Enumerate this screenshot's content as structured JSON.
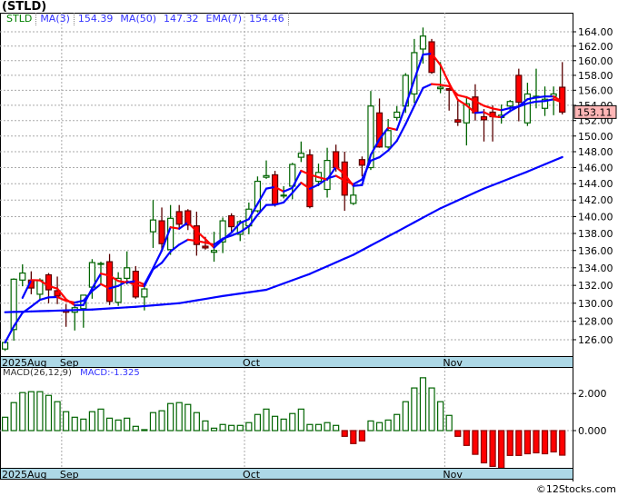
{
  "title": "(STLD)",
  "legend": {
    "symbol": "STLD",
    "ma3_label": "MA(3)",
    "ma3_value": "154.39",
    "ma50_label": "MA(50)",
    "ma50_value": "147.32",
    "ema7_label": "EMA(7)",
    "ema7_value": "154.46"
  },
  "last_price_label": "153.11",
  "macd_legend": {
    "label": "MACD(26,12,9)",
    "value": "MACD:-1.325"
  },
  "copyright": "©12Stocks.com",
  "colors": {
    "up": "#006400",
    "down": "#ff0000",
    "ma_up": "#0000ff",
    "ma_down": "#ff0000",
    "axis_band": "#add8e6",
    "last_price_bg": "#ffb6b6",
    "symbol_text": "#008000",
    "legend_text": "#3333ff"
  },
  "chart_data": [
    {
      "type": "candlestick",
      "symbol": "STLD",
      "y_scale": "log",
      "ylim": [
        124.2,
        166.6
      ],
      "y_ticks": [
        "126.00",
        "128.00",
        "130.00",
        "132.00",
        "134.00",
        "136.00",
        "138.00",
        "140.00",
        "142.00",
        "144.00",
        "146.00",
        "148.00",
        "150.00",
        "152.00",
        "154.00",
        "156.00",
        "158.00",
        "160.00",
        "162.00",
        "164.00"
      ],
      "x_labels": [
        {
          "label": "2025Aug",
          "index": 0
        },
        {
          "label": "Sep",
          "index": 7
        },
        {
          "label": "Oct",
          "index": 28
        },
        {
          "label": "Nov",
          "index": 51
        }
      ],
      "grid": true,
      "ohlc": [
        [
          125.0,
          125.9,
          124.8,
          125.7
        ],
        [
          127.1,
          132.8,
          125.9,
          132.7
        ],
        [
          132.6,
          134.4,
          131.9,
          133.4
        ],
        [
          132.6,
          133.6,
          131.0,
          131.7
        ],
        [
          131.0,
          132.8,
          130.4,
          132.6
        ],
        [
          133.2,
          133.4,
          130.0,
          131.5
        ],
        [
          131.4,
          133.0,
          129.9,
          130.8
        ],
        [
          129.2,
          129.9,
          127.4,
          129.0
        ],
        [
          129.0,
          129.9,
          127.0,
          129.5
        ],
        [
          129.4,
          130.9,
          127.3,
          130.9
        ],
        [
          131.8,
          135.0,
          130.5,
          134.6
        ],
        [
          134.4,
          134.7,
          132.1,
          134.5
        ],
        [
          134.7,
          135.6,
          129.8,
          130.2
        ],
        [
          130.1,
          133.5,
          129.7,
          132.8
        ],
        [
          132.8,
          135.9,
          132.1,
          134.0
        ],
        [
          133.6,
          134.2,
          130.5,
          130.7
        ],
        [
          130.7,
          131.9,
          129.2,
          131.6
        ],
        [
          138.2,
          142.0,
          136.3,
          139.6
        ],
        [
          139.5,
          141.1,
          135.9,
          136.8
        ],
        [
          136.1,
          141.4,
          135.5,
          139.8
        ],
        [
          140.6,
          141.4,
          138.7,
          139.1
        ],
        [
          140.7,
          140.9,
          138.4,
          139.0
        ],
        [
          138.9,
          140.6,
          135.4,
          136.7
        ],
        [
          136.5,
          137.6,
          136.1,
          136.3
        ],
        [
          135.8,
          138.2,
          134.7,
          136.0
        ],
        [
          137.0,
          139.9,
          135.7,
          139.5
        ],
        [
          140.1,
          140.4,
          138.2,
          138.8
        ],
        [
          137.9,
          139.6,
          137.1,
          139.4
        ],
        [
          138.9,
          141.7,
          137.9,
          140.9
        ],
        [
          140.7,
          144.9,
          140.5,
          144.3
        ],
        [
          144.8,
          146.9,
          144.6,
          145.0
        ],
        [
          145.1,
          145.6,
          141.2,
          141.5
        ],
        [
          142.5,
          143.7,
          142.2,
          142.6
        ],
        [
          143.7,
          146.6,
          142.1,
          146.4
        ],
        [
          147.3,
          149.3,
          146.7,
          147.8
        ],
        [
          147.6,
          148.3,
          141.0,
          141.2
        ],
        [
          144.3,
          146.5,
          143.7,
          145.4
        ],
        [
          143.3,
          148.5,
          142.3,
          146.9
        ],
        [
          148.0,
          148.9,
          145.5,
          146.0
        ],
        [
          146.7,
          148.0,
          140.7,
          142.6
        ],
        [
          141.6,
          143.7,
          141.4,
          142.6
        ],
        [
          147.0,
          147.4,
          144.9,
          146.3
        ],
        [
          146.0,
          155.9,
          145.7,
          153.9
        ],
        [
          153.0,
          154.9,
          148.5,
          148.6
        ],
        [
          148.6,
          152.2,
          148.4,
          150.7
        ],
        [
          152.4,
          153.9,
          152.0,
          153.1
        ],
        [
          153.9,
          158.3,
          153.0,
          158.0
        ],
        [
          155.5,
          163.0,
          154.3,
          161.1
        ],
        [
          161.6,
          164.6,
          159.6,
          163.4
        ],
        [
          162.6,
          163.0,
          158.2,
          158.4
        ],
        [
          156.2,
          159.8,
          155.6,
          156.4
        ],
        [
          156.2,
          156.3,
          153.3,
          156.0
        ],
        [
          152.1,
          154.6,
          151.3,
          151.8
        ],
        [
          151.7,
          155.2,
          148.8,
          154.2
        ],
        [
          155.1,
          156.8,
          152.0,
          153.0
        ],
        [
          152.5,
          153.5,
          149.3,
          152.1
        ],
        [
          153.1,
          154.0,
          149.3,
          152.5
        ],
        [
          152.4,
          154.1,
          151.6,
          152.7
        ],
        [
          153.9,
          154.7,
          153.1,
          154.5
        ],
        [
          158.0,
          158.9,
          151.9,
          154.4
        ],
        [
          151.7,
          157.0,
          151.3,
          155.5
        ],
        [
          155.0,
          158.9,
          153.6,
          155.2
        ],
        [
          153.6,
          156.5,
          152.6,
          154.8
        ],
        [
          155.2,
          156.5,
          152.7,
          155.5
        ],
        [
          156.4,
          159.8,
          152.8,
          153.11
        ]
      ],
      "ma50": [
        129.0,
        129.03,
        129.06,
        129.09,
        129.12,
        129.15,
        129.18,
        129.21,
        129.24,
        129.27,
        129.3,
        129.36,
        129.42,
        129.48,
        129.54,
        129.6,
        129.68,
        129.76,
        129.84,
        129.92,
        130.0,
        130.16,
        130.32,
        130.48,
        130.64,
        130.8,
        130.94,
        131.08,
        131.22,
        131.36,
        131.5,
        131.86,
        132.22,
        132.58,
        132.94,
        133.3,
        133.74,
        134.18,
        134.62,
        135.06,
        135.5,
        136.04,
        136.58,
        137.12,
        137.66,
        138.2,
        138.76,
        139.32,
        139.88,
        140.44,
        141.0,
        141.48,
        141.96,
        142.44,
        142.92,
        143.4,
        143.82,
        144.24,
        144.66,
        145.08,
        145.5,
        145.96,
        146.41,
        146.87,
        147.32
      ],
      "overlays": [
        "MA(3)",
        "EMA(7)",
        "MA(50)"
      ]
    },
    {
      "type": "bar",
      "title": "MACD(26,12,9)",
      "ylim": [
        -2.05,
        3.5
      ],
      "y_ticks": [
        "2.000",
        "0.000"
      ],
      "x_labels": [
        {
          "label": "2025Aug",
          "index": 0
        },
        {
          "label": "Sep",
          "index": 7
        },
        {
          "label": "Oct",
          "index": 28
        },
        {
          "label": "Nov",
          "index": 51
        }
      ],
      "values": [
        0.72,
        1.51,
        2.05,
        2.1,
        2.1,
        1.9,
        1.56,
        1.02,
        0.72,
        0.62,
        1.02,
        1.16,
        0.67,
        0.57,
        0.67,
        0.23,
        0.05,
        0.97,
        1.07,
        1.46,
        1.51,
        1.41,
        0.97,
        0.52,
        0.13,
        0.33,
        0.28,
        0.28,
        0.43,
        0.87,
        1.16,
        0.77,
        0.62,
        0.92,
        1.16,
        0.33,
        0.33,
        0.43,
        0.28,
        -0.31,
        -0.7,
        -0.56,
        0.52,
        0.43,
        0.57,
        0.87,
        1.56,
        2.3,
        2.85,
        2.3,
        1.56,
        0.82,
        -0.31,
        -0.8,
        -1.28,
        -1.74,
        -1.93,
        -2.03,
        -1.34,
        -1.34,
        -1.25,
        -1.2,
        -1.25,
        -1.15,
        -1.325
      ]
    }
  ]
}
